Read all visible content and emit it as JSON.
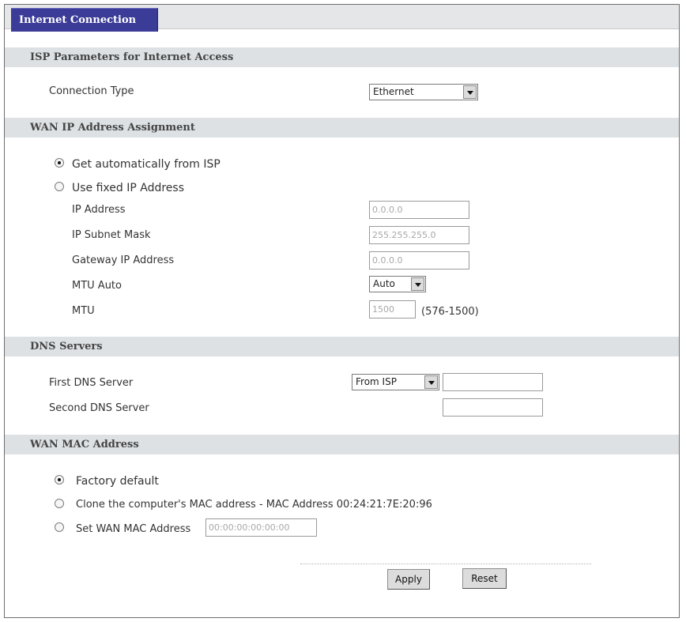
{
  "tab": {
    "label": "Internet Connection"
  },
  "sections": {
    "isp": "ISP Parameters for Internet Access",
    "wan_ip": "WAN IP Address Assignment",
    "dns": "DNS Servers",
    "wan_mac": "WAN MAC Address"
  },
  "isp": {
    "connection_type_label": "Connection Type",
    "connection_type_value": "Ethernet"
  },
  "wan_ip": {
    "auto_label": "Get automatically from ISP",
    "fixed_label": "Use fixed IP Address",
    "selected": "auto",
    "ip_address_label": "IP Address",
    "ip_address_value": "0.0.0.0",
    "subnet_label": "IP Subnet Mask",
    "subnet_value": "255.255.255.0",
    "gateway_label": "Gateway IP Address",
    "gateway_value": "0.0.0.0",
    "mtu_auto_label": "MTU Auto",
    "mtu_auto_value": "Auto",
    "mtu_label": "MTU",
    "mtu_value": "1500",
    "mtu_range": "(576-1500)"
  },
  "dns": {
    "first_label": "First DNS Server",
    "first_mode": "From ISP",
    "first_value": "",
    "second_label": "Second DNS Server",
    "second_value": ""
  },
  "wan_mac": {
    "factory_label": "Factory default",
    "clone_label": "Clone the computer's MAC address - MAC Address 00:24:21:7E:20:96",
    "set_label": "Set WAN MAC Address",
    "set_value": "00:00:00:00:00:00",
    "selected": "factory"
  },
  "buttons": {
    "apply": "Apply",
    "reset": "Reset"
  }
}
